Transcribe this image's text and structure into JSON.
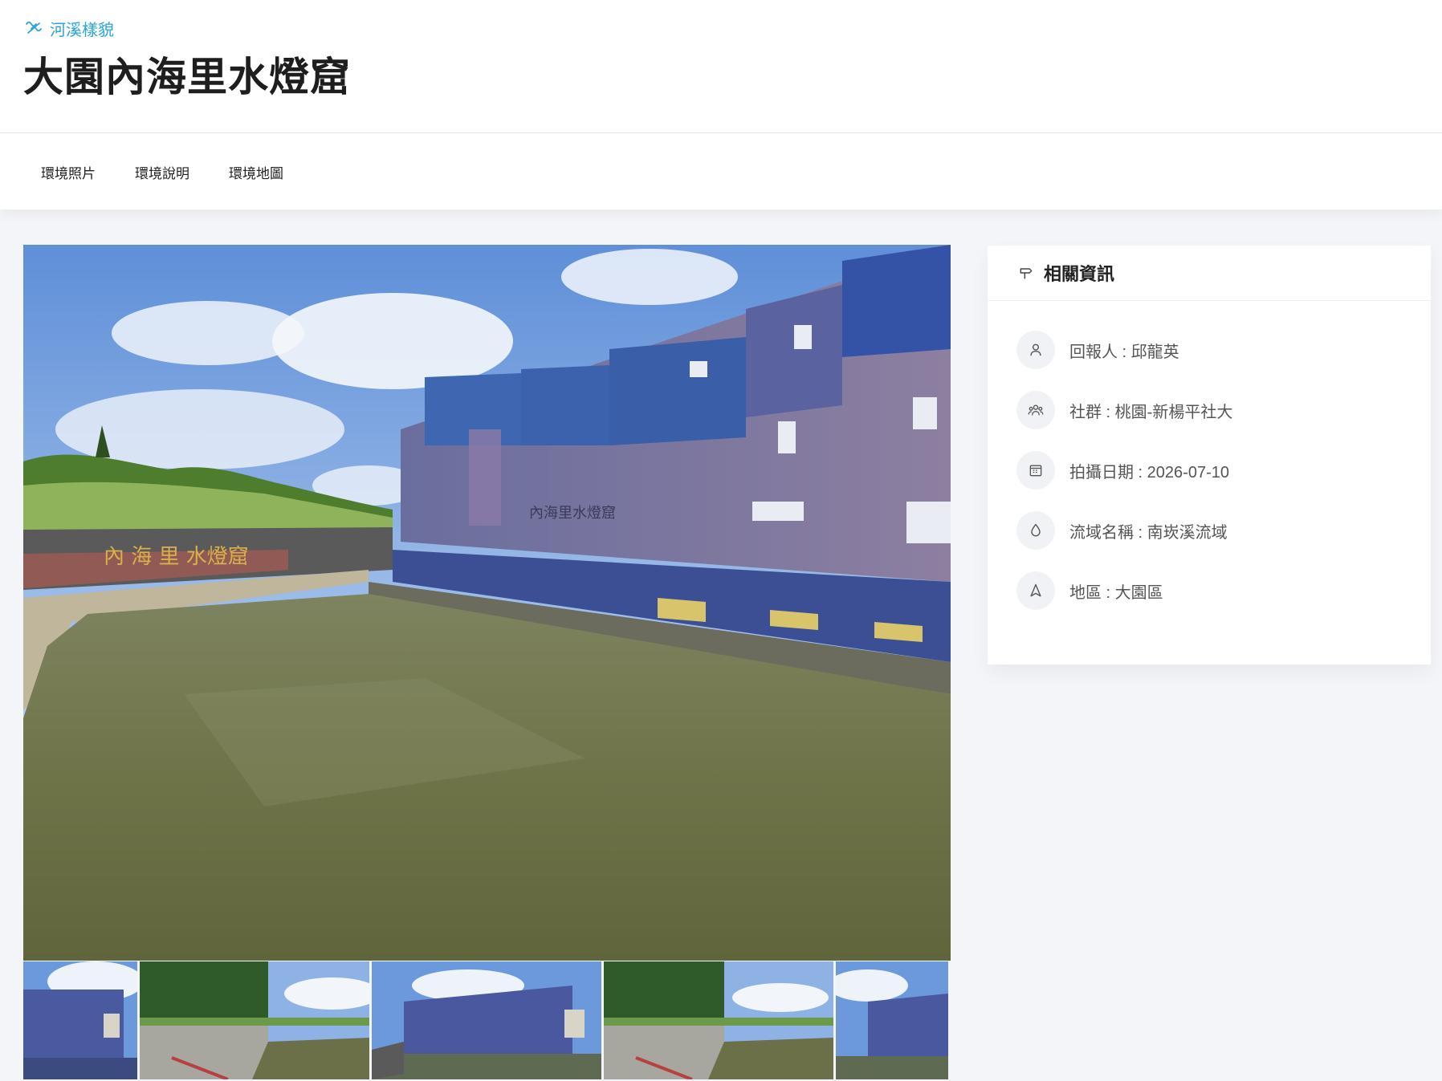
{
  "header": {
    "breadcrumb": "河溪樣貌",
    "title": "大園內海里水燈窟"
  },
  "tabs": [
    {
      "label": "環境照片"
    },
    {
      "label": "環境說明"
    },
    {
      "label": "環境地圖"
    }
  ],
  "photo": {
    "wall_sign": "內海里水燈窟",
    "fence_sign": "內 海 里 水燈窟"
  },
  "info": {
    "title": "相關資訊",
    "rows": [
      {
        "icon": "user-icon",
        "text": "回報人 : 邱龍英"
      },
      {
        "icon": "community-icon",
        "text": "社群 : 桃園-新楊平社大"
      },
      {
        "icon": "calendar-icon",
        "text": "拍攝日期 : 2026-07-10"
      },
      {
        "icon": "water-drop-icon",
        "text": "流域名稱 : 南崁溪流域"
      },
      {
        "icon": "location-icon",
        "text": "地區 : 大園區"
      }
    ]
  },
  "colors": {
    "accent": "#2aa3d8",
    "page_bg": "#f4f5f9",
    "panel_bg": "#ffffff"
  }
}
